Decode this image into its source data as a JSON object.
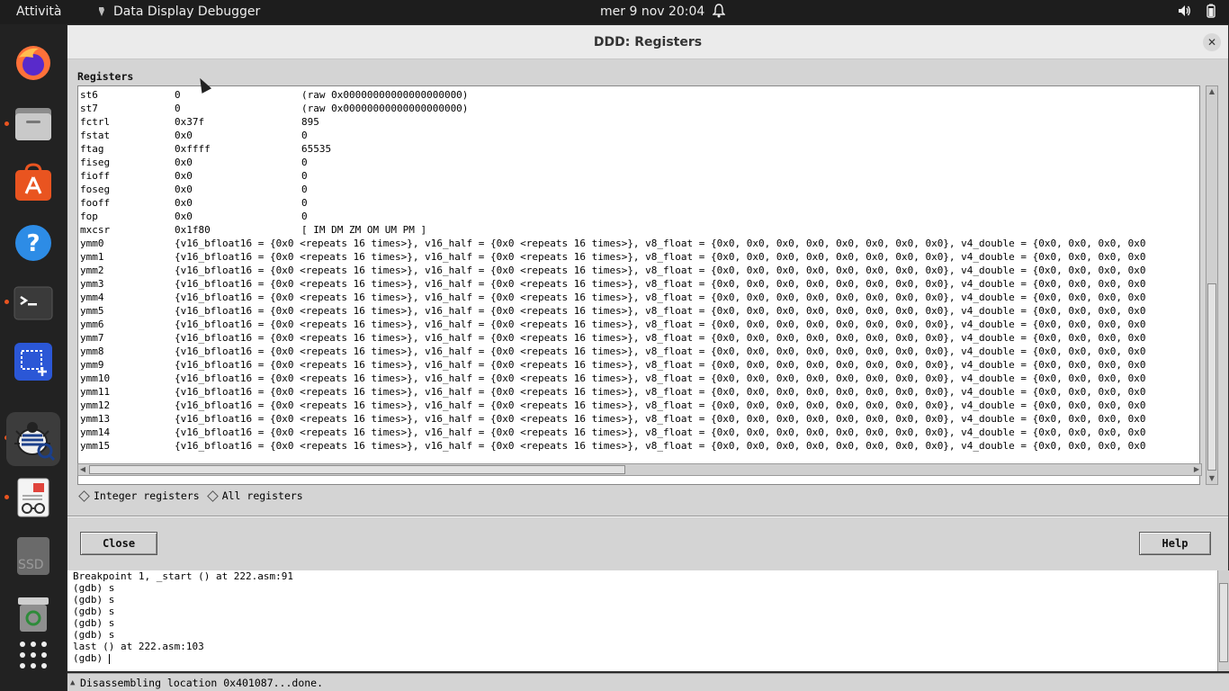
{
  "topbar": {
    "activities": "Attività",
    "app_name": "Data Display Debugger",
    "clock": "mer 9 nov  20:04"
  },
  "dock": {
    "items": [
      {
        "name": "firefox",
        "icon": "firefox-icon",
        "running": false
      },
      {
        "name": "files",
        "icon": "files-icon",
        "running": true
      },
      {
        "name": "software",
        "icon": "software-store-icon",
        "running": false
      },
      {
        "name": "help",
        "icon": "help-icon",
        "running": false
      },
      {
        "name": "terminal",
        "icon": "terminal-icon",
        "running": true
      },
      {
        "name": "screenshot",
        "icon": "screenshot-icon",
        "running": false
      },
      {
        "name": "ddd",
        "icon": "ddd-bug-icon",
        "running": true
      },
      {
        "name": "document-viewer",
        "icon": "document-viewer-icon",
        "running": true
      },
      {
        "name": "ssd",
        "icon": "drive-icon",
        "label": "SSD",
        "running": false
      },
      {
        "name": "trash",
        "icon": "trash-icon",
        "running": false
      },
      {
        "name": "apps",
        "icon": "app-grid-icon",
        "running": false
      }
    ]
  },
  "window": {
    "title": "DDD: Registers",
    "registers_label": "Registers",
    "registers": [
      {
        "name": "st6",
        "hex": "0",
        "value": "(raw 0x00000000000000000000)"
      },
      {
        "name": "st7",
        "hex": "0",
        "value": "(raw 0x00000000000000000000)"
      },
      {
        "name": "fctrl",
        "hex": "0x37f",
        "value": "895"
      },
      {
        "name": "fstat",
        "hex": "0x0",
        "value": "0"
      },
      {
        "name": "ftag",
        "hex": "0xffff",
        "value": "65535"
      },
      {
        "name": "fiseg",
        "hex": "0x0",
        "value": "0"
      },
      {
        "name": "fioff",
        "hex": "0x0",
        "value": "0"
      },
      {
        "name": "foseg",
        "hex": "0x0",
        "value": "0"
      },
      {
        "name": "fooff",
        "hex": "0x0",
        "value": "0"
      },
      {
        "name": "fop",
        "hex": "0x0",
        "value": "0"
      },
      {
        "name": "mxcsr",
        "hex": "0x1f80",
        "value": "[ IM DM ZM OM UM PM ]"
      },
      {
        "name": "ymm0",
        "hex": "{v16_bfloat16 = {0x0 <repeats 16 times>}, v16_half = {0x0 <repeats 16 times>}, v8_float = {0x0, 0x0, 0x0, 0x0, 0x0, 0x0, 0x0, 0x0}, v4_double = {0x0, 0x0, 0x0, 0x0",
        "value": ""
      },
      {
        "name": "ymm1",
        "hex": "{v16_bfloat16 = {0x0 <repeats 16 times>}, v16_half = {0x0 <repeats 16 times>}, v8_float = {0x0, 0x0, 0x0, 0x0, 0x0, 0x0, 0x0, 0x0}, v4_double = {0x0, 0x0, 0x0, 0x0",
        "value": ""
      },
      {
        "name": "ymm2",
        "hex": "{v16_bfloat16 = {0x0 <repeats 16 times>}, v16_half = {0x0 <repeats 16 times>}, v8_float = {0x0, 0x0, 0x0, 0x0, 0x0, 0x0, 0x0, 0x0}, v4_double = {0x0, 0x0, 0x0, 0x0",
        "value": ""
      },
      {
        "name": "ymm3",
        "hex": "{v16_bfloat16 = {0x0 <repeats 16 times>}, v16_half = {0x0 <repeats 16 times>}, v8_float = {0x0, 0x0, 0x0, 0x0, 0x0, 0x0, 0x0, 0x0}, v4_double = {0x0, 0x0, 0x0, 0x0",
        "value": ""
      },
      {
        "name": "ymm4",
        "hex": "{v16_bfloat16 = {0x0 <repeats 16 times>}, v16_half = {0x0 <repeats 16 times>}, v8_float = {0x0, 0x0, 0x0, 0x0, 0x0, 0x0, 0x0, 0x0}, v4_double = {0x0, 0x0, 0x0, 0x0",
        "value": ""
      },
      {
        "name": "ymm5",
        "hex": "{v16_bfloat16 = {0x0 <repeats 16 times>}, v16_half = {0x0 <repeats 16 times>}, v8_float = {0x0, 0x0, 0x0, 0x0, 0x0, 0x0, 0x0, 0x0}, v4_double = {0x0, 0x0, 0x0, 0x0",
        "value": ""
      },
      {
        "name": "ymm6",
        "hex": "{v16_bfloat16 = {0x0 <repeats 16 times>}, v16_half = {0x0 <repeats 16 times>}, v8_float = {0x0, 0x0, 0x0, 0x0, 0x0, 0x0, 0x0, 0x0}, v4_double = {0x0, 0x0, 0x0, 0x0",
        "value": ""
      },
      {
        "name": "ymm7",
        "hex": "{v16_bfloat16 = {0x0 <repeats 16 times>}, v16_half = {0x0 <repeats 16 times>}, v8_float = {0x0, 0x0, 0x0, 0x0, 0x0, 0x0, 0x0, 0x0}, v4_double = {0x0, 0x0, 0x0, 0x0",
        "value": ""
      },
      {
        "name": "ymm8",
        "hex": "{v16_bfloat16 = {0x0 <repeats 16 times>}, v16_half = {0x0 <repeats 16 times>}, v8_float = {0x0, 0x0, 0x0, 0x0, 0x0, 0x0, 0x0, 0x0}, v4_double = {0x0, 0x0, 0x0, 0x0",
        "value": ""
      },
      {
        "name": "ymm9",
        "hex": "{v16_bfloat16 = {0x0 <repeats 16 times>}, v16_half = {0x0 <repeats 16 times>}, v8_float = {0x0, 0x0, 0x0, 0x0, 0x0, 0x0, 0x0, 0x0}, v4_double = {0x0, 0x0, 0x0, 0x0",
        "value": ""
      },
      {
        "name": "ymm10",
        "hex": "{v16_bfloat16 = {0x0 <repeats 16 times>}, v16_half = {0x0 <repeats 16 times>}, v8_float = {0x0, 0x0, 0x0, 0x0, 0x0, 0x0, 0x0, 0x0}, v4_double = {0x0, 0x0, 0x0, 0x0",
        "value": ""
      },
      {
        "name": "ymm11",
        "hex": "{v16_bfloat16 = {0x0 <repeats 16 times>}, v16_half = {0x0 <repeats 16 times>}, v8_float = {0x0, 0x0, 0x0, 0x0, 0x0, 0x0, 0x0, 0x0}, v4_double = {0x0, 0x0, 0x0, 0x0",
        "value": ""
      },
      {
        "name": "ymm12",
        "hex": "{v16_bfloat16 = {0x0 <repeats 16 times>}, v16_half = {0x0 <repeats 16 times>}, v8_float = {0x0, 0x0, 0x0, 0x0, 0x0, 0x0, 0x0, 0x0}, v4_double = {0x0, 0x0, 0x0, 0x0",
        "value": ""
      },
      {
        "name": "ymm13",
        "hex": "{v16_bfloat16 = {0x0 <repeats 16 times>}, v16_half = {0x0 <repeats 16 times>}, v8_float = {0x0, 0x0, 0x0, 0x0, 0x0, 0x0, 0x0, 0x0}, v4_double = {0x0, 0x0, 0x0, 0x0",
        "value": ""
      },
      {
        "name": "ymm14",
        "hex": "{v16_bfloat16 = {0x0 <repeats 16 times>}, v16_half = {0x0 <repeats 16 times>}, v8_float = {0x0, 0x0, 0x0, 0x0, 0x0, 0x0, 0x0, 0x0}, v4_double = {0x0, 0x0, 0x0, 0x0",
        "value": ""
      },
      {
        "name": "ymm15",
        "hex": "{v16_bfloat16 = {0x0 <repeats 16 times>}, v16_half = {0x0 <repeats 16 times>}, v8_float = {0x0, 0x0, 0x0, 0x0, 0x0, 0x0, 0x0, 0x0}, v4_double = {0x0, 0x0, 0x0, 0x0",
        "value": ""
      }
    ],
    "radio_integer": "Integer registers",
    "radio_all": "All registers",
    "close_label": "Close",
    "help_label": "Help"
  },
  "console": {
    "lines": [
      "Breakpoint 1, _start () at 222.asm:91",
      "(gdb) s",
      "(gdb) s",
      "(gdb) s",
      "(gdb) s",
      "(gdb) s",
      "last () at 222.asm:103",
      "(gdb) "
    ]
  },
  "status": "Disassembling location 0x401087...done."
}
